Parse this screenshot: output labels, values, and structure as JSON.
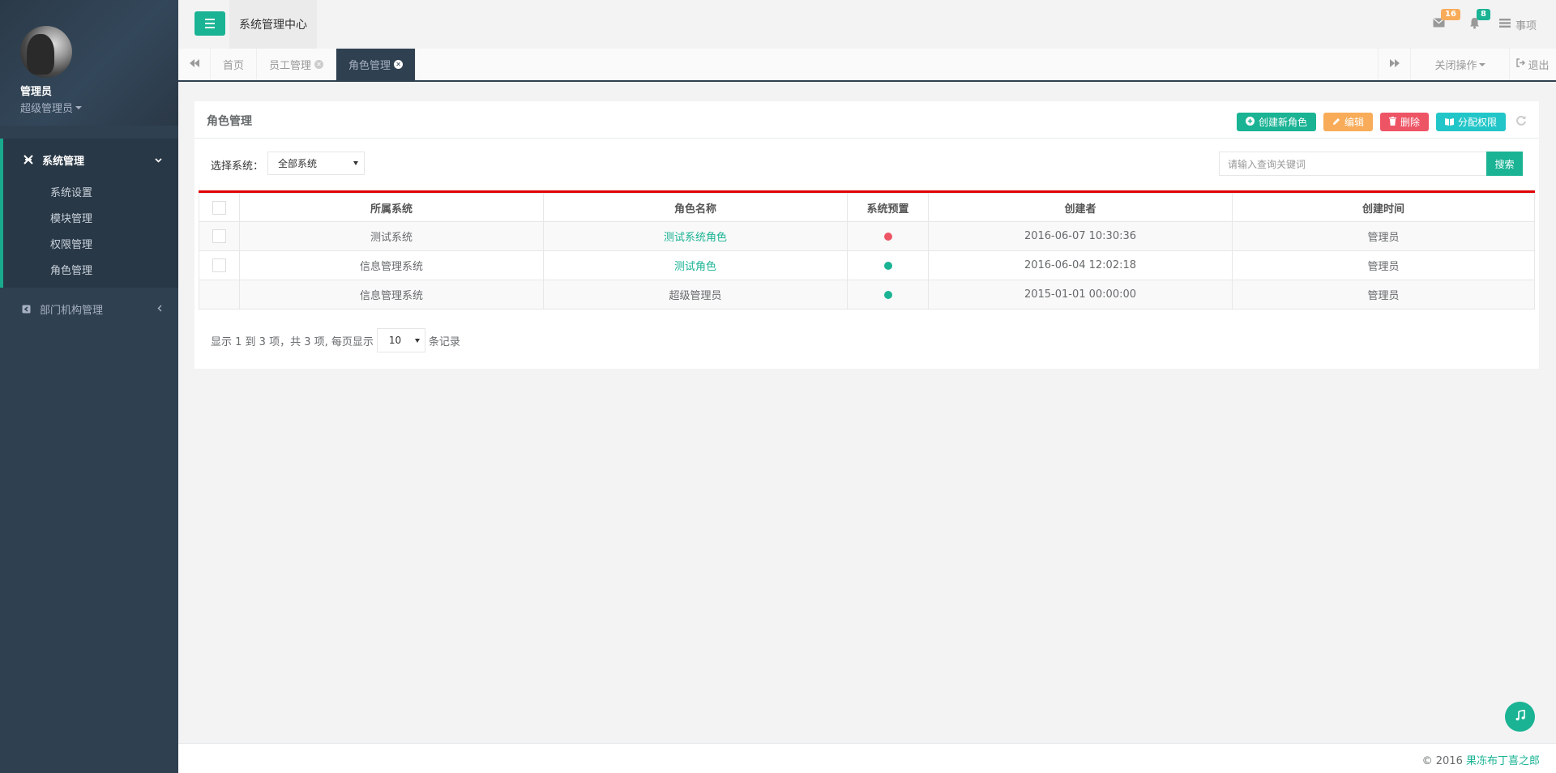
{
  "user": {
    "name": "管理员",
    "role": "超级管理员"
  },
  "nav": [
    {
      "label": "系统管理",
      "expanded": true,
      "children": [
        "系统设置",
        "模块管理",
        "权限管理",
        "角色管理"
      ]
    },
    {
      "label": "部门机构管理",
      "expanded": false,
      "children": []
    }
  ],
  "header": {
    "system_title": "系统管理中心",
    "mail_count": "16",
    "notify_count": "8",
    "todo_label": "事项"
  },
  "tabs": [
    {
      "label": "首页",
      "closable": false
    },
    {
      "label": "员工管理",
      "closable": true
    },
    {
      "label": "角色管理",
      "closable": true,
      "active": true
    }
  ],
  "tabbar": {
    "close_ops_label": "关闭操作",
    "logout_label": "退出"
  },
  "panel": {
    "title": "角色管理",
    "buttons": {
      "create": "创建新角色",
      "edit": "编辑",
      "delete": "删除",
      "assign": "分配权限"
    },
    "filter_label": "选择系统：",
    "filter_value": "全部系统",
    "search_placeholder": "请输入查询关键词",
    "search_button": "搜索"
  },
  "table": {
    "columns": [
      "所属系统",
      "角色名称",
      "系统预置",
      "创建者",
      "创建时间"
    ],
    "rows": [
      {
        "system": "测试系统",
        "role": "测试系统角色",
        "preset": "red",
        "creator": "2016-06-07 10:30:36",
        "created": "管理员",
        "selectable": true,
        "role_link": true
      },
      {
        "system": "信息管理系统",
        "role": "测试角色",
        "preset": "green",
        "creator": "2016-06-04 12:02:18",
        "created": "管理员",
        "selectable": true,
        "role_link": true
      },
      {
        "system": "信息管理系统",
        "role": "超级管理员",
        "preset": "green",
        "creator": "2015-01-01 00:00:00",
        "created": "管理员",
        "selectable": false,
        "role_link": false
      }
    ]
  },
  "pager": {
    "info": "显示 1 到 3 项，共 3 项, 每页显示",
    "page_size": "10",
    "suffix": "条记录"
  },
  "footer": {
    "copyright": "© 2016",
    "brand": "果冻布丁喜之郎"
  },
  "colors": {
    "primary": "#1ab394",
    "sidebar": "#2f4050",
    "warning": "#f8ac59",
    "danger": "#ed5565",
    "info": "#23c6c8",
    "table_top_border": "#e00000"
  }
}
